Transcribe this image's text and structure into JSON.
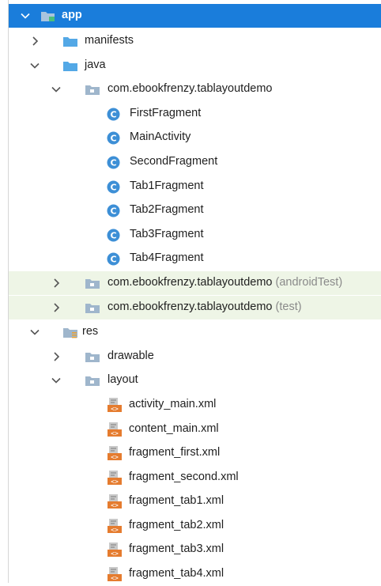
{
  "tree": {
    "app": {
      "label": "app"
    },
    "manifests": {
      "label": "manifests"
    },
    "java": {
      "label": "java"
    },
    "pkg_main": {
      "label": "com.ebookfrenzy.tablayoutdemo"
    },
    "classes": [
      {
        "label": "FirstFragment"
      },
      {
        "label": "MainActivity"
      },
      {
        "label": "SecondFragment"
      },
      {
        "label": "Tab1Fragment"
      },
      {
        "label": "Tab2Fragment"
      },
      {
        "label": "Tab3Fragment"
      },
      {
        "label": "Tab4Fragment"
      }
    ],
    "pkg_android_test": {
      "label": "com.ebookfrenzy.tablayoutdemo",
      "suffix": "(androidTest)"
    },
    "pkg_test": {
      "label": "com.ebookfrenzy.tablayoutdemo",
      "suffix": "(test)"
    },
    "res": {
      "label": "res"
    },
    "drawable": {
      "label": "drawable"
    },
    "layout": {
      "label": "layout"
    },
    "layout_files": [
      {
        "label": "activity_main.xml"
      },
      {
        "label": "content_main.xml"
      },
      {
        "label": "fragment_first.xml"
      },
      {
        "label": "fragment_second.xml"
      },
      {
        "label": "fragment_tab1.xml"
      },
      {
        "label": "fragment_tab2.xml"
      },
      {
        "label": "fragment_tab3.xml"
      },
      {
        "label": "fragment_tab4.xml"
      }
    ]
  },
  "colors": {
    "selection": "#1a7ddb",
    "test_tint": "#eef5e6",
    "folder": "#9fb6cc",
    "source_folder": "#53a8e6",
    "class_badge": "#3d8fd6",
    "xml_orange": "#e57c2f",
    "suffix_text": "#8a8a8a"
  },
  "icons": {
    "expanded": "chevron-down-icon",
    "collapsed": "chevron-right-icon",
    "module": "module-folder-icon",
    "folder": "folder-icon",
    "package": "package-icon",
    "class": "class-icon",
    "xml": "xml-file-icon"
  }
}
